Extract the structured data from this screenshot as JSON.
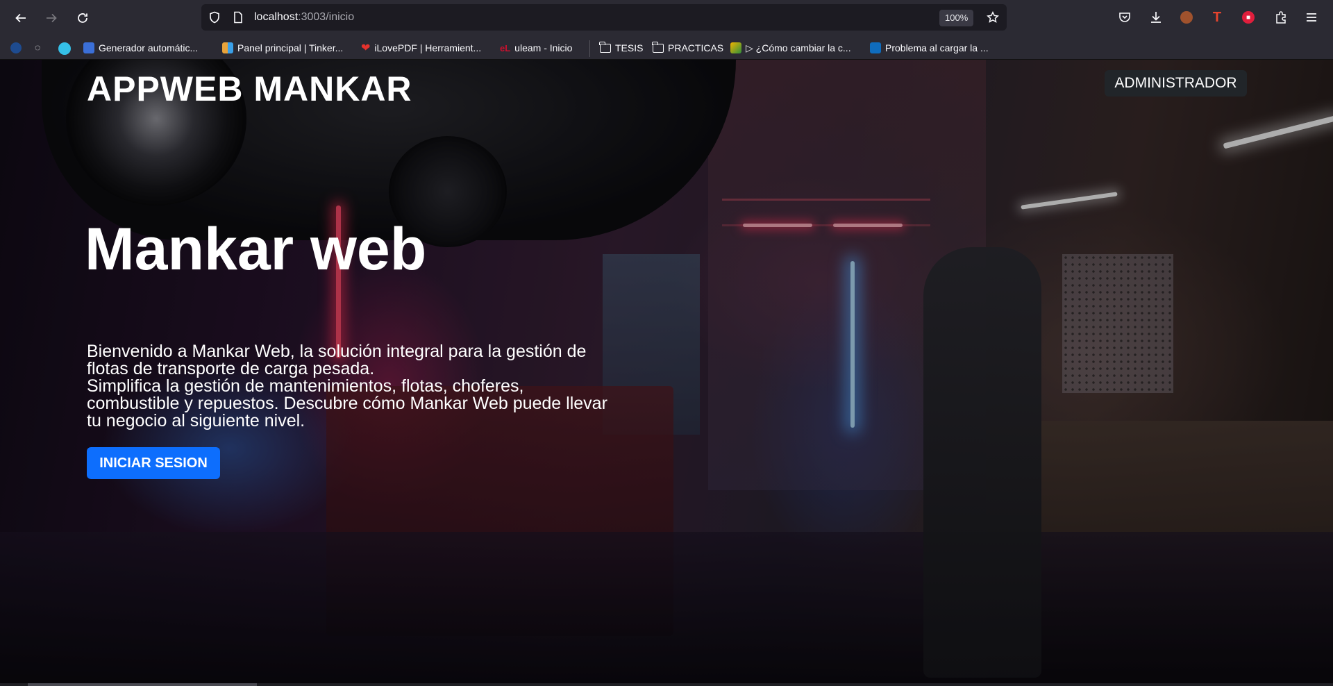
{
  "browser": {
    "url_host": "localhost",
    "url_path": ":3003/inicio",
    "zoom": "100%",
    "bookmarks": [
      {
        "label": "Generador automátic...",
        "color": "#3b6fd8"
      },
      {
        "label": "Panel principal | Tinker...",
        "color": "#e8a33a"
      },
      {
        "label": "iLovePDF | Herramient...",
        "color": "#e5322d"
      },
      {
        "label": "uleam - Inicio",
        "color": "#c8102e"
      },
      {
        "label": "TESIS",
        "color": "#fbfbfe"
      },
      {
        "label": "PRACTICAS",
        "color": "#fbfbfe"
      },
      {
        "label": "▷ ¿Cómo cambiar la c...",
        "color": "#f0b400"
      },
      {
        "label": "Problema al cargar la ...",
        "color": "#0f6cbd"
      }
    ]
  },
  "page": {
    "brand": "APPWEB MANKAR",
    "admin_button": "ADMINISTRADOR",
    "hero_title": "Mankar web",
    "hero_text_1": "Bienvenido a Mankar Web, la solución integral para la gestión de flotas de transporte de carga pesada.",
    "hero_text_2": "Simplifica la gestión de mantenimientos, flotas, choferes, combustible y repuestos. Descubre cómo Mankar Web puede llevar tu negocio al siguiente nivel.",
    "login_button": "INICIAR SESION",
    "colors": {
      "primary": "#0d6efd",
      "dark": "#212529"
    }
  }
}
